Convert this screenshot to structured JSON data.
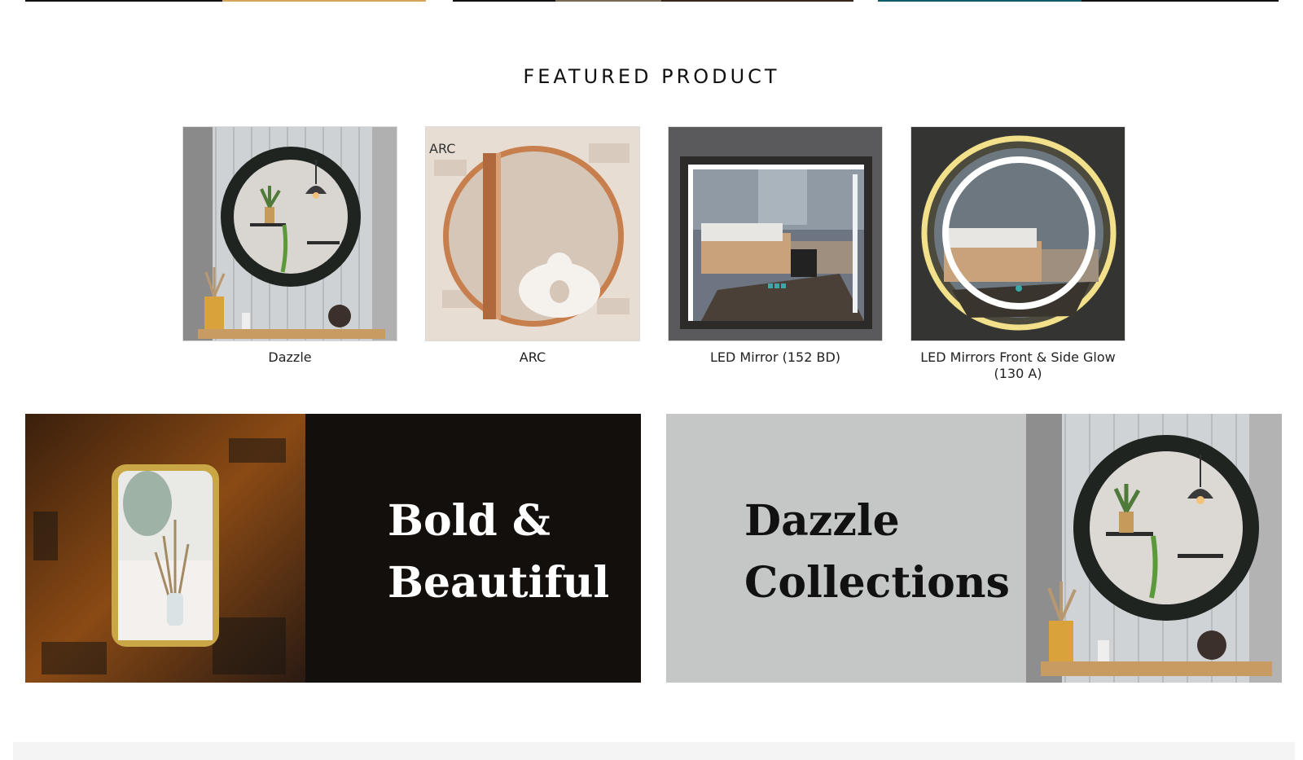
{
  "section": {
    "title": "FEATURED PRODUCT"
  },
  "products": [
    {
      "name": "Dazzle"
    },
    {
      "name": "ARC",
      "image_label": "ARC"
    },
    {
      "name": "LED Mirror (152 BD)"
    },
    {
      "name": "LED Mirrors Front & Side Glow (130 A)"
    }
  ],
  "banners": [
    {
      "line1": "Bold &",
      "line2": "Beautiful"
    },
    {
      "line1": "Dazzle",
      "line2": "Collections"
    }
  ]
}
